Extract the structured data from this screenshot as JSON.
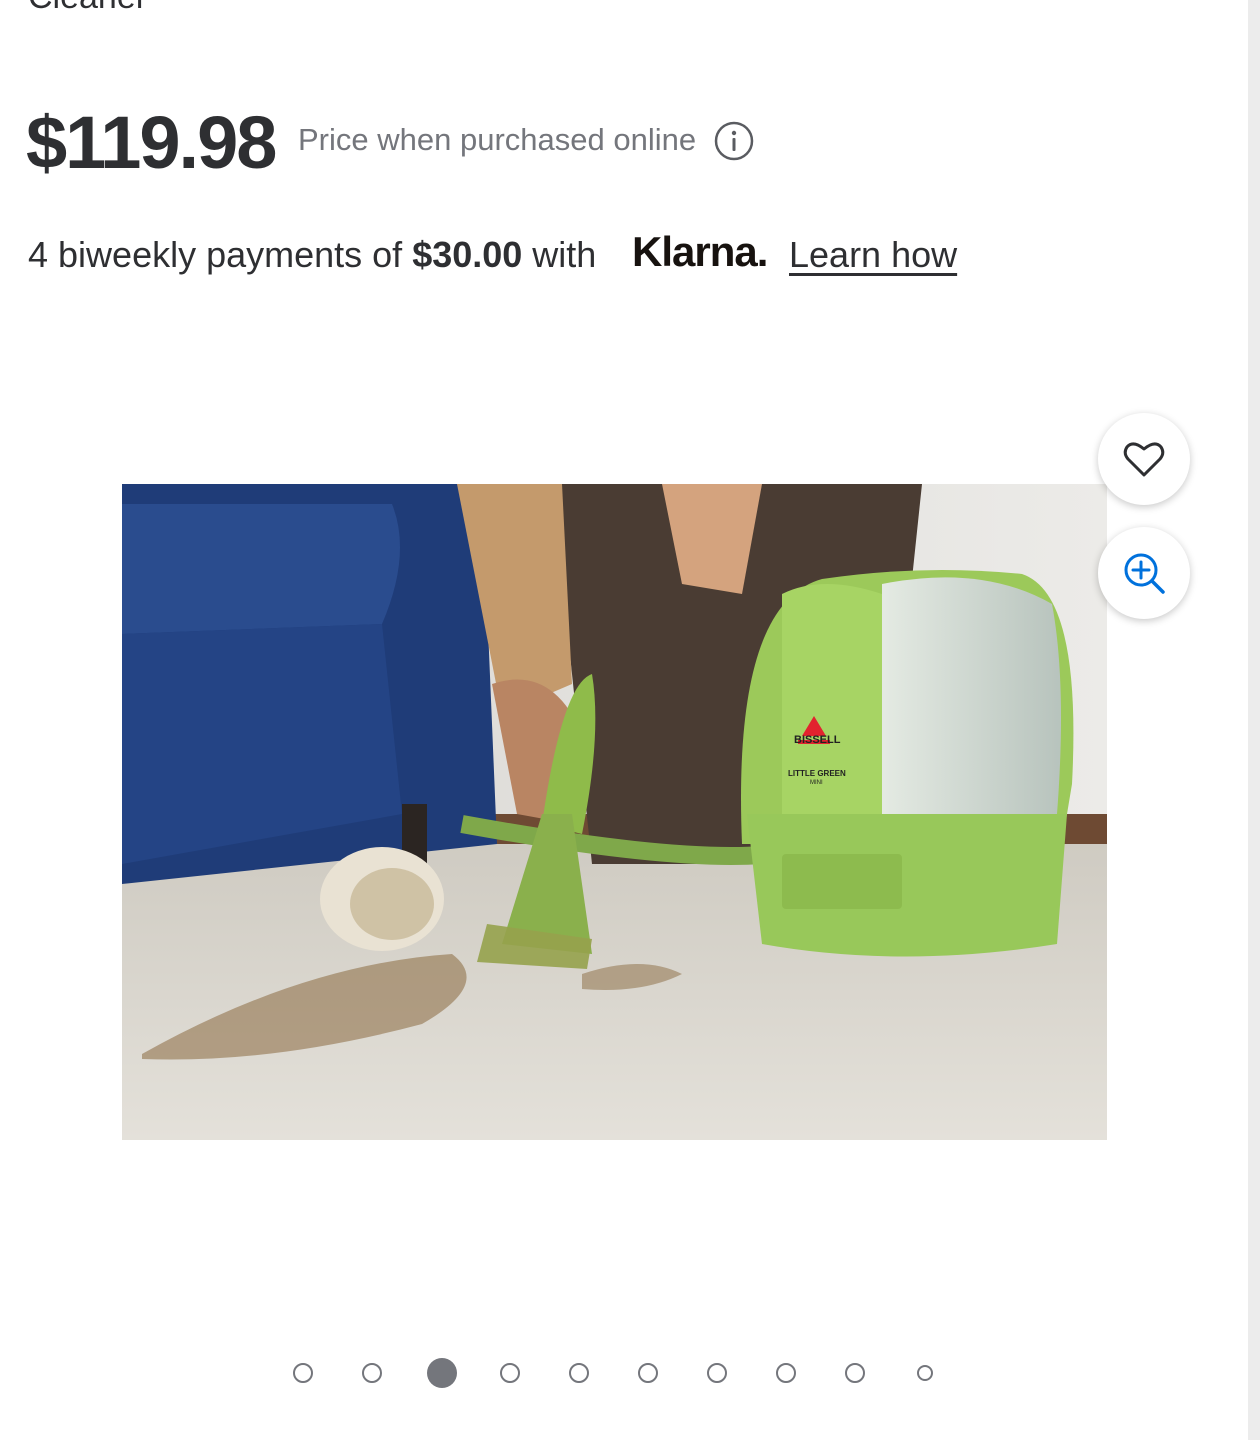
{
  "product": {
    "title_fragment": "Cleaner"
  },
  "price": {
    "amount": "$119.98",
    "note": "Price when purchased online"
  },
  "klarna": {
    "prefix": "4 biweekly payments of ",
    "amount": "$30.00",
    "suffix": " with",
    "brand": "Klarna.",
    "link": "Learn how"
  },
  "product_image": {
    "brand_text": "BISSELL",
    "model_text": "LITTLE GREEN",
    "model_sub": "MINI"
  },
  "carousel": {
    "count": 10,
    "active_index": 2
  },
  "icons": {
    "favorite": "heart-icon",
    "zoom": "zoom-in-icon",
    "info": "info-icon"
  },
  "colors": {
    "text": "#2e2f32",
    "muted": "#74767c",
    "link_blue": "#0071dc"
  }
}
